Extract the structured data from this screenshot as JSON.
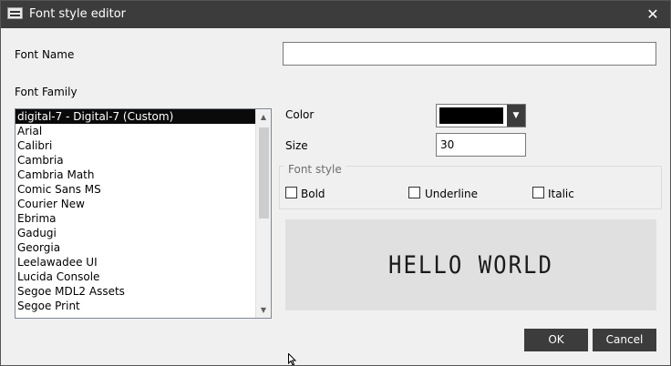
{
  "window": {
    "title": "Font style editor",
    "close_glyph": "✕"
  },
  "form": {
    "font_name_label": "Font Name",
    "font_name_value": "",
    "font_family_label": "Font Family",
    "font_family_items": [
      "digital-7 - Digital-7 (Custom)",
      "Arial",
      "Calibri",
      "Cambria",
      "Cambria Math",
      "Comic Sans MS",
      "Courier New",
      "Ebrima",
      "Gadugi",
      "Georgia",
      "Leelawadee UI",
      "Lucida Console",
      "Segoe MDL2 Assets",
      "Segoe Print"
    ],
    "selected_index": 0,
    "color_label": "Color",
    "color_value": "#000000",
    "size_label": "Size",
    "size_value": "30",
    "font_style_legend": "Font style",
    "bold_label": "Bold",
    "underline_label": "Underline",
    "italic_label": "Italic",
    "preview_text": "HELLO WORLD"
  },
  "buttons": {
    "ok_label": "OK",
    "cancel_label": "Cancel"
  },
  "icons": {
    "app": "app-icon",
    "close": "close-icon",
    "scroll_up": "▲",
    "scroll_down": "▼",
    "dropdown": "▼"
  }
}
